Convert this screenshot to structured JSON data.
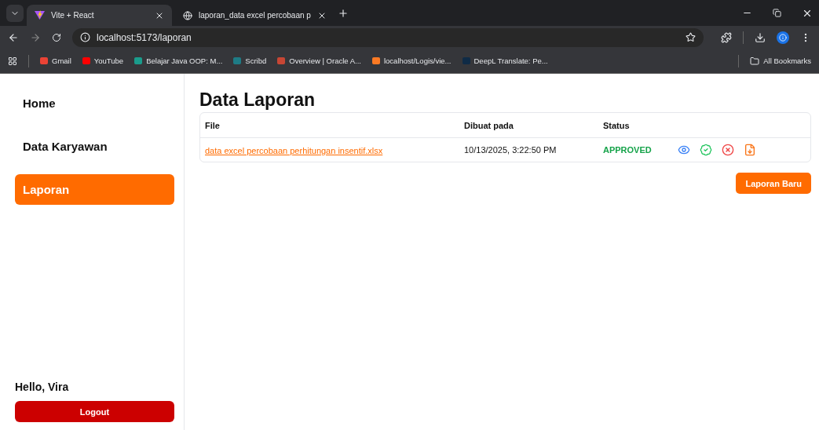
{
  "browser": {
    "tabs": [
      {
        "title": "Vite + React",
        "selected": true
      },
      {
        "title": "laporan_data excel percobaan p",
        "selected": false
      }
    ],
    "url": "localhost:5173/laporan",
    "bookmarks": [
      {
        "label": "Gmail",
        "color": "#ea4335"
      },
      {
        "label": "YouTube",
        "color": "#ff0000"
      },
      {
        "label": "Belajar Java OOP: M...",
        "color": "#1a9c8c"
      },
      {
        "label": "Scribd",
        "color": "#1e7b85"
      },
      {
        "label": "Overview | Oracle A...",
        "color": "#c74634"
      },
      {
        "label": "localhost/Logis/vie...",
        "color": "#fb7a24"
      },
      {
        "label": "DeepL Translate: Pe...",
        "color": "#0f2b46"
      }
    ],
    "all_bookmarks": "All Bookmarks"
  },
  "sidebar": {
    "items": [
      {
        "label": "Home",
        "selected": false
      },
      {
        "label": "Data Karyawan",
        "selected": false
      },
      {
        "label": "Laporan",
        "selected": true
      }
    ],
    "greeting": "Hello, Vira",
    "logout": "Logout"
  },
  "main": {
    "title": "Data Laporan",
    "table": {
      "columns": [
        "File",
        "Dibuat pada",
        "Status"
      ],
      "rows": [
        {
          "file": "data excel percobaan perhitungan insentif.xlsx",
          "created": "10/13/2025, 3:22:50 PM",
          "status": "APPROVED",
          "color": "#16a34a"
        }
      ]
    },
    "new_button": "Laporan Baru"
  }
}
